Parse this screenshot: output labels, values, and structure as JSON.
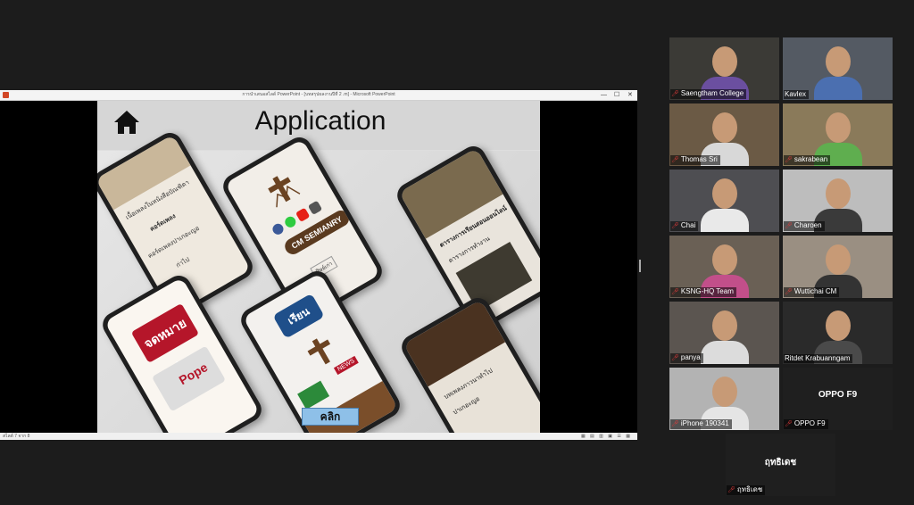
{
  "window": {
    "title": "การนำเสนอสไลด์ PowerPoint - [บทสรุปผลงานปีที่ 2 .m] - Microsoft PowerPoint",
    "controls": [
      "—",
      "☐",
      "✕"
    ]
  },
  "slide": {
    "title": "Application",
    "click_label": "คลิก",
    "phones": {
      "p1_lines": [
        "เนื้อเพลงในหนังสือบัณฑิตา",
        "คอร์ดเพลง",
        "คอร์ดเพลงปาเกอะญอ",
        "ก่าไป"
      ],
      "p2_pill": "CM SEMIANRY",
      "p2_small": "ศิษย์เก่า",
      "p3_lines": [
        "ตารางการเรียนสอนออนไลน์",
        "ตารางการทำงาน"
      ],
      "p4_red": "จดหมายข่าว",
      "p4_pope": "Pope",
      "p5_blue": "เรียน",
      "p5_news": "NEWS",
      "p6_lines": [
        "บทเพลงภาวนาทำไป",
        "ปาเกอะญอ"
      ]
    }
  },
  "statusbar": {
    "left": "สไลด์ 7 จาก 8",
    "right": "▦ ▤ ▥ ▣ ☰ ▦"
  },
  "participants": [
    {
      "name": "Saengtham College",
      "muted": true,
      "video": true
    },
    {
      "name": "Kavlex",
      "muted": false,
      "video": true
    },
    {
      "name": "Thomas Sri",
      "muted": true,
      "video": true
    },
    {
      "name": "sakrabean",
      "muted": true,
      "video": true
    },
    {
      "name": "Chai",
      "muted": true,
      "video": true
    },
    {
      "name": "Charoen",
      "muted": true,
      "video": true
    },
    {
      "name": "KSNG-HQ Team",
      "muted": true,
      "video": true
    },
    {
      "name": "Wuttichai CM",
      "muted": true,
      "video": true
    },
    {
      "name": "panya",
      "muted": true,
      "video": true
    },
    {
      "name": "Ritdet Krabuanngam",
      "muted": false,
      "video": true,
      "active": true
    },
    {
      "name": "iPhone 190341",
      "muted": true,
      "video": true
    },
    {
      "name": "OPPO F9",
      "muted": true,
      "video": false,
      "display": "OPPO F9"
    },
    {
      "name": "ฤทธิเดช",
      "muted": true,
      "video": false,
      "display": "ฤทธิเดช"
    }
  ],
  "colors": {
    "background": "#1c1c1c",
    "active_speaker": "#e6e13c",
    "muted_icon": "#e23b3b",
    "powerpoint": "#d24726"
  }
}
